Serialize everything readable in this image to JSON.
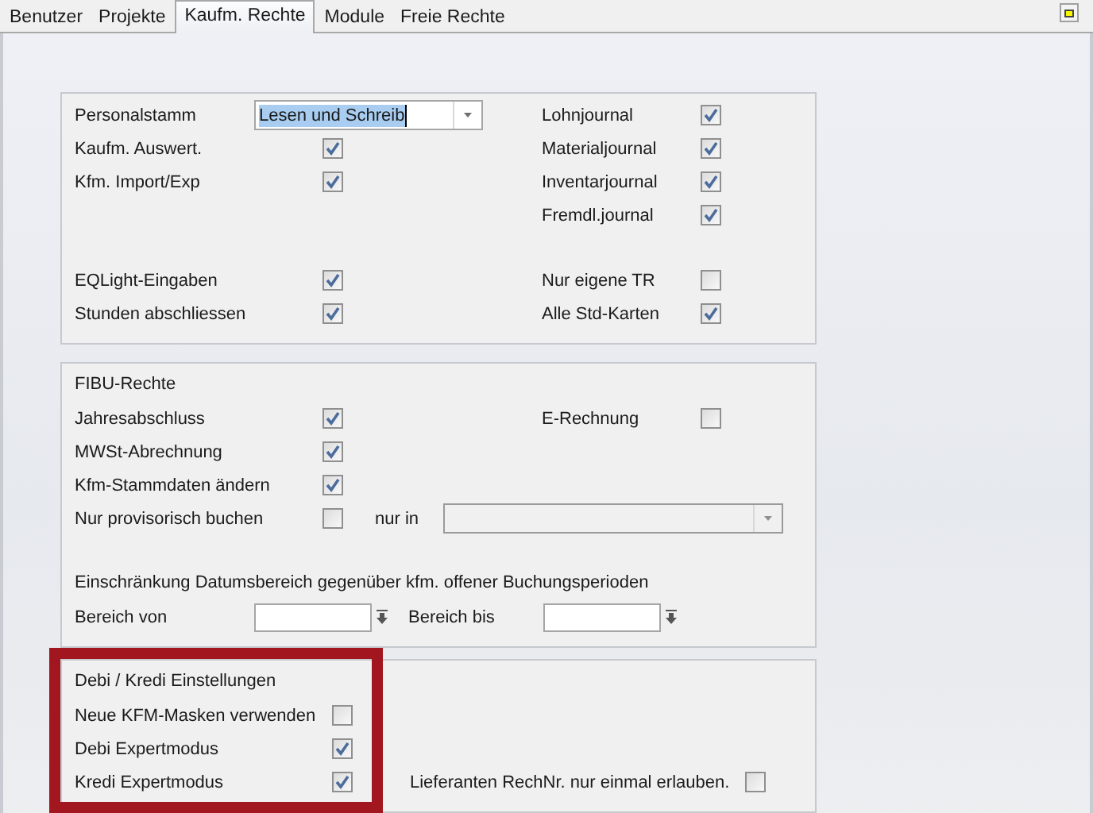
{
  "tabs": [
    {
      "label": "Benutzer",
      "selected": false
    },
    {
      "label": "Projekte",
      "selected": false
    },
    {
      "label": "Kaufm. Rechte",
      "selected": true
    },
    {
      "label": "Module",
      "selected": false
    },
    {
      "label": "Freie Rechte",
      "selected": false
    }
  ],
  "groups": [
    {
      "sections": [
        {
          "rows": [
            {
              "left": {
                "kind": "combo",
                "label": "Personalstamm",
                "value": "Lesen und Schreib",
                "disabled": false
              },
              "right": {
                "kind": "check",
                "label": "Lohnjournal",
                "checked": true
              }
            },
            {
              "left": {
                "kind": "check",
                "label": "Kaufm. Auswert.",
                "checked": true
              },
              "right": {
                "kind": "check",
                "label": "Materialjournal",
                "checked": true
              }
            },
            {
              "left": {
                "kind": "check",
                "label": "Kfm. Import/Exp",
                "checked": true
              },
              "right": {
                "kind": "check",
                "label": "Inventarjournal",
                "checked": true
              }
            },
            {
              "right": {
                "kind": "check",
                "label": "Fremdl.journal",
                "checked": true
              }
            }
          ]
        },
        {
          "rows": [
            {
              "left": {
                "kind": "check",
                "label": "EQLight-Eingaben",
                "checked": true
              },
              "right": {
                "kind": "check",
                "label": "Nur eigene TR",
                "checked": false
              }
            },
            {
              "left": {
                "kind": "check",
                "label": "Stunden abschliessen",
                "checked": true
              },
              "right": {
                "kind": "check",
                "label": "Alle Std-Karten",
                "checked": true
              }
            }
          ]
        }
      ]
    },
    {
      "title": "FIBU-Rechte",
      "sections": [
        {
          "rows": [
            {
              "left": {
                "kind": "check",
                "label": "Jahresabschluss",
                "checked": true
              },
              "right": {
                "kind": "check",
                "label": "E-Rechnung",
                "checked": false
              }
            },
            {
              "left": {
                "kind": "check",
                "label": "MWSt-Abrechnung",
                "checked": true
              }
            },
            {
              "left": {
                "kind": "check",
                "label": "Kfm-Stammdaten ändern",
                "checked": true
              }
            },
            {
              "left": {
                "kind": "check",
                "label": "Nur provisorisch buchen",
                "checked": false
              },
              "right": {
                "kind": "combo",
                "label": "nur in",
                "disabled": true
              }
            }
          ]
        },
        {
          "note": "Einschränkung Datumsbereich gegenüber kfm. offener Buchungsperioden",
          "rows": [
            {
              "left": {
                "kind": "date",
                "label": "Bereich von"
              },
              "right": {
                "kind": "date",
                "label": "Bereich bis"
              }
            }
          ]
        }
      ]
    },
    {
      "title": "Debi / Kredi Einstellungen",
      "sections": [
        {
          "rows": [
            {
              "left": {
                "kind": "check",
                "label": "Neue KFM-Masken verwenden",
                "checked": false
              }
            },
            {
              "left": {
                "kind": "check",
                "label": "Debi Expertmodus",
                "checked": true
              }
            },
            {
              "left": {
                "kind": "check",
                "label": "Kredi Expertmodus",
                "checked": true
              },
              "right": {
                "kind": "check",
                "label": "Lieferanten RechNr. nur einmal erlauben.",
                "checked": false
              }
            }
          ]
        }
      ]
    }
  ]
}
